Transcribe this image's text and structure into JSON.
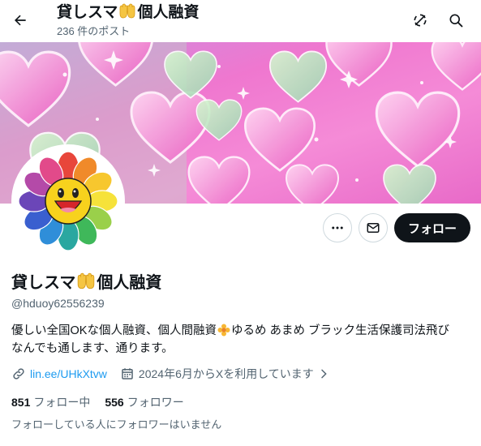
{
  "header": {
    "name_prefix": "貸しスマ",
    "name_suffix": "個人融資",
    "post_count": "236 件のポスト"
  },
  "profile": {
    "name_prefix": "貸しスマ",
    "name_suffix": "個人融資",
    "handle": "@hduoy62556239",
    "bio_part1": "優しい全国OKな個人融資、個人間融資",
    "bio_part2": "ゆるめ あまめ ブラック生活保護司法飛び",
    "bio_line2": "なんでも通します、通ります。",
    "link": "lin.ee/UHkXtvw",
    "joined": "2024年6月からXを利用しています",
    "following_count": "851",
    "following_label": "フォロー中",
    "followers_count": "556",
    "followers_label": "フォロワー",
    "mutual_note": "フォローしている人にフォロワーはいません"
  },
  "actions": {
    "follow_label": "フォロー"
  },
  "icons": {
    "back": "arrow-left-icon",
    "sync": "refresh-icon",
    "search": "search-icon",
    "more": "more-horizontal-icon",
    "message": "envelope-icon",
    "link": "link-icon",
    "calendar": "calendar-icon",
    "chevron": "chevron-right-icon"
  },
  "colors": {
    "text": "#0f1419",
    "secondary": "#536471",
    "link": "#1d9bf0",
    "follow_button": "#0f1419",
    "banner_base": "#e866c8"
  }
}
